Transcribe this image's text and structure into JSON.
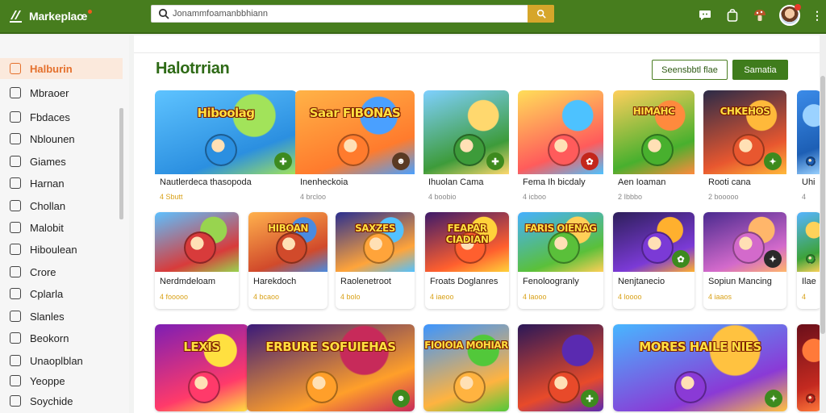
{
  "app": {
    "title": "Markeplaœ",
    "brand_color": "#477d1e",
    "accent_color": "#e4702c"
  },
  "search": {
    "value": "Jonammfoamanbbhiann",
    "placeholder": ""
  },
  "top_icons": [
    "chat-icon",
    "bag-icon",
    "mushroom-icon",
    "avatar",
    "more-icon"
  ],
  "sidebar": {
    "items": [
      {
        "label": "Halburin",
        "icon": "store-icon",
        "active": true
      },
      {
        "label": "Mbraoer",
        "icon": "monitor-icon"
      },
      {
        "label": "Fbdaces",
        "icon": "tag-icon"
      },
      {
        "label": "Nblounen",
        "icon": "chat-icon"
      },
      {
        "label": "Giames",
        "icon": "gamepad-icon"
      },
      {
        "label": "Harnan",
        "icon": "edit-icon"
      },
      {
        "label": "Chollan",
        "icon": "clock-icon"
      },
      {
        "label": "Malobit",
        "icon": "grid-icon"
      },
      {
        "label": "Hiboulean",
        "icon": "pin-icon"
      },
      {
        "label": "Crore",
        "icon": "calendar-icon"
      },
      {
        "label": "Cplarla",
        "icon": "shield-icon"
      },
      {
        "label": "Slanles",
        "icon": "chart-icon"
      },
      {
        "label": "Beokorn",
        "icon": "book-icon"
      },
      {
        "label": "Unaoplblan",
        "icon": "flag-icon"
      },
      {
        "label": "Yeoppe",
        "icon": "scissors-icon"
      },
      {
        "label": "Soychide",
        "icon": "check-icon"
      }
    ]
  },
  "main": {
    "title": "Halotrrian",
    "buttons": {
      "outline": "Seensbbtl flae",
      "solid": "Samatia"
    },
    "rows": [
      [
        {
          "thumb_text": "Hiboolag",
          "title": "Nautlerdeca thasopoda",
          "meta": "4 Sbutt",
          "badge": "✚",
          "badge_color": "#3d8a1e"
        },
        {
          "thumb_text": "Saar FIBONAS",
          "title": "Inenheckoia",
          "meta": "4 brcloo",
          "badge": "☻",
          "badge_color": "#5a3a24"
        },
        {
          "thumb_text": "",
          "title": "Ihuolan Cama",
          "meta": "4 boobio",
          "badge": "✚",
          "badge_color": "#3d8a1e"
        },
        {
          "thumb_text": "",
          "title": "Fema Ih bicdaly",
          "meta": "4 icboo",
          "badge": "✿",
          "badge_color": "#c3261b"
        },
        {
          "thumb_text": "HIMAHC",
          "title": "Aen Ioaman",
          "meta": "2 Ibbbo",
          "badge": "",
          "badge_color": ""
        },
        {
          "thumb_text": "CHKEHOS",
          "title": "Rooti cana",
          "meta": "2 booooo",
          "badge": "✦",
          "badge_color": "#3d8a1e"
        },
        {
          "thumb_text": "",
          "title": "Uhi",
          "meta": "4",
          "badge": "",
          "badge_color": ""
        }
      ],
      [
        {
          "thumb_text": "",
          "title": "Nerdmdeloam",
          "meta": "4 fooooo",
          "badge": "",
          "badge_color": ""
        },
        {
          "thumb_text": "HIBOAN",
          "title": "Harekdoch",
          "meta": "4 bcaoo",
          "badge": "",
          "badge_color": ""
        },
        {
          "thumb_text": "SAXZES",
          "title": "Raolenetroot",
          "meta": "4 bolo",
          "badge": "",
          "badge_color": ""
        },
        {
          "thumb_text": "FEAPAR CIADIAN",
          "title": "Froats Doglanres",
          "meta": "4 iaeoo",
          "badge": "",
          "badge_color": ""
        },
        {
          "thumb_text": "FARIS OIENAG",
          "title": "Fenoloogranly",
          "meta": "4 laooo",
          "badge": "",
          "badge_color": ""
        },
        {
          "thumb_text": "",
          "title": "Nenjtanecio",
          "meta": "4 loooo",
          "badge": "✿",
          "badge_color": "#3d8a1e"
        },
        {
          "thumb_text": "",
          "title": "Sopiun Mancing",
          "meta": "4 iaaos",
          "badge": "✦",
          "badge_color": "#2a2a2a"
        },
        {
          "thumb_text": "",
          "title": "Ilae",
          "meta": "4",
          "badge": "",
          "badge_color": ""
        }
      ],
      [
        {
          "thumb_text": "LEXIS",
          "title": "",
          "meta": "",
          "badge": "",
          "badge_color": ""
        },
        {
          "thumb_text": "ERBURE SOFUIEHAS",
          "title": "",
          "meta": "",
          "badge": "☻",
          "badge_color": "#3d8a1e"
        },
        {
          "thumb_text": "FIOIOIA MOHIAR",
          "title": "",
          "meta": "",
          "badge": "",
          "badge_color": ""
        },
        {
          "thumb_text": "",
          "title": "",
          "meta": "",
          "badge": "✚",
          "badge_color": "#3d8a1e"
        },
        {
          "thumb_text": "MORES HAILE NIES",
          "title": "",
          "meta": "",
          "badge": "✦",
          "badge_color": "#3d8a1e"
        },
        {
          "thumb_text": "",
          "title": "",
          "meta": "",
          "badge": "",
          "badge_color": ""
        }
      ]
    ]
  }
}
